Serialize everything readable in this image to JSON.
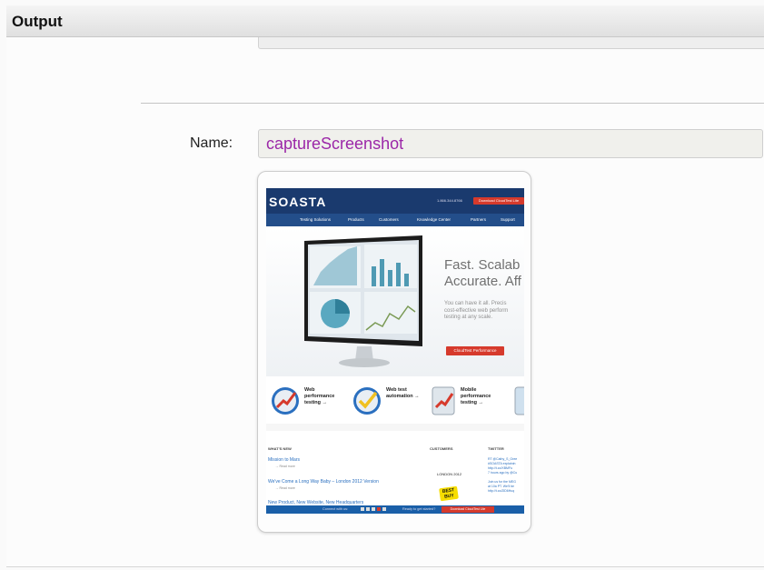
{
  "panel": {
    "title": "Output"
  },
  "form": {
    "name_label": "Name:",
    "name_value": "captureScreenshot"
  },
  "screenshot": {
    "logo": "SOASTA",
    "phone": "1.866.344.8766",
    "top_cta": "Download CloudTest Lite",
    "nav": [
      "Testing Solutions",
      "Products",
      "Customers",
      "Knowledge Center",
      "Partners",
      "Support"
    ],
    "hero_title_1": "Fast. Scalab",
    "hero_title_2": "Accurate. Aff",
    "hero_text_1": "You can have it all. Precis",
    "hero_text_2": "cost-effective web perform",
    "hero_text_3": "testing at any scale.",
    "hero_cta": "CloudTest Performance",
    "features": [
      {
        "line1": "Web",
        "line2": "performance",
        "line3": "testing →"
      },
      {
        "line1": "Web test",
        "line2": "automation →",
        "line3": ""
      },
      {
        "line1": "Mobile",
        "line2": "performance",
        "line3": "testing →"
      }
    ],
    "columns": {
      "news": "WHAT'S NEW",
      "customers": "CUSTOMERS",
      "twitter": "TWITTER"
    },
    "news": [
      {
        "title": "Mission to Mars",
        "more": "→ Read more"
      },
      {
        "title": "We've Come a Long Way Baby – London 2012 Version",
        "more": "→ Read more"
      },
      {
        "title": "New Product, New Website, New Headquarters",
        "more": ""
      }
    ],
    "customer_logos": {
      "london": "LONDON 2012",
      "bestbuy": "BEST BUY"
    },
    "tweets": [
      "RT @Cathy_S_Gree",
      "#SOASTA explainin",
      "http://t.co/XBMFu",
      "7 hours ago by @Cu",
      "",
      "Join us for the MEG",
      "at 10a PT. We'll be",
      "http://t.co/ZiD6Huq"
    ],
    "footer_connect": "Connect with us:",
    "footer_ready": "Ready to get started?",
    "footer_cta": "Download CloudTest Lite"
  }
}
